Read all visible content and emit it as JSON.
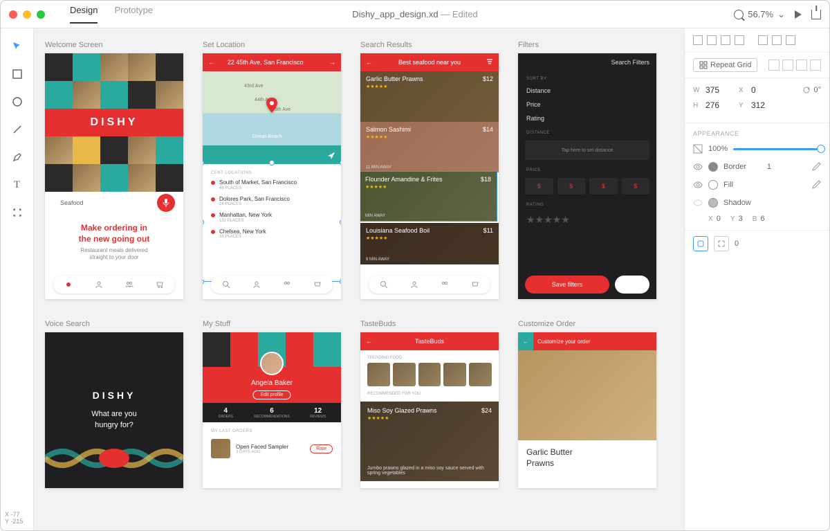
{
  "titlebar": {
    "modes": [
      "Design",
      "Prototype"
    ],
    "active_mode": 0,
    "document": "Dishy_app_design.xd",
    "edited": " — Edited",
    "zoom": "56.7%"
  },
  "coords": {
    "x": "X   -77",
    "y": "Y   -215"
  },
  "artboards_row1": [
    {
      "label": "Welcome Screen"
    },
    {
      "label": "Set Location"
    },
    {
      "label": "Search Results"
    },
    {
      "label": "Filters"
    }
  ],
  "artboards_row2": [
    {
      "label": "Voice Search"
    },
    {
      "label": "My Stuff"
    },
    {
      "label": "TasteBuds"
    },
    {
      "label": "Customize Order"
    }
  ],
  "welcome": {
    "logo": "DISHY",
    "search": "Seafood",
    "tagline": "Make ordering in\nthe new going out",
    "sub": "Restaurant meals delivered\nstraight to your door"
  },
  "location": {
    "header": "22 45th Ave, San Francisco",
    "streets": [
      "43rd Ave",
      "44th Ave",
      "45th Ave",
      "Ocean Beach"
    ],
    "section": "CENT LOCATIONS",
    "items": [
      {
        "name": "South of Market, San Francisco",
        "sub": "46 PLACES"
      },
      {
        "name": "Dolores Park, San Francisco",
        "sub": "24 PLACES"
      },
      {
        "name": "Manhattan, New York",
        "sub": "133 PLACES"
      },
      {
        "name": "Chelsea, New York",
        "sub": "39 PLACES"
      }
    ]
  },
  "search": {
    "header": "Best seafood near you",
    "dishes": [
      {
        "name": "Garlic Butter Prawns",
        "price": "$12",
        "stars": "★★★★★",
        "dist": ""
      },
      {
        "name": "Salmon Sashimi",
        "price": "$14",
        "stars": "★★★★★",
        "dist": "11 MIN AWAY"
      },
      {
        "name": "Flounder Amandine & Frites",
        "price": "$18",
        "stars": "★★★★★",
        "dist": "MIN AWAY"
      },
      {
        "name": "Louisiana Seafood Boil",
        "price": "$11",
        "stars": "★★★★★",
        "dist": "8 MIN AWAY"
      }
    ]
  },
  "filters": {
    "header": "Search Filters",
    "sortby": "SORT BY",
    "opts": [
      "Distance",
      "Price",
      "Rating"
    ],
    "distance": "DISTANCE",
    "dist_hint": "Tap here to set distance",
    "price": "PRICE",
    "p_symbols": [
      "$",
      "$",
      "$",
      "$"
    ],
    "rating": "RATING",
    "save": "Save filters"
  },
  "voice": {
    "logo": "DISHY",
    "q": "What are you\nhungry for?"
  },
  "mystuff": {
    "name": "Angela Baker",
    "edit": "Edit profile",
    "stats": [
      {
        "n": "4",
        "l": "ORDERS"
      },
      {
        "n": "6",
        "l": "RECOMMENDATIONS"
      },
      {
        "n": "12",
        "l": "REVIEWS"
      }
    ],
    "orders_h": "MY LAST ORDERS",
    "order": {
      "name": "Open Faced Sampler",
      "date": "3 DAYS AGO",
      "rate": "Rate"
    }
  },
  "tastebuds": {
    "header": "TasteBuds",
    "s1": "TRENDING FOOD",
    "s2": "RECOMMENDED FOR YOU",
    "card": {
      "name": "Miso Soy Glazed Prawns",
      "price": "$24",
      "stars": "★★★★★",
      "desc": "Jumbo prawns glazed in a miso soy sauce served with spring vegetables"
    }
  },
  "customize": {
    "header": "Customize your order",
    "name": "Garlic Butter\nPrawns"
  },
  "panel": {
    "repeat": "Repeat Grid",
    "w": "375",
    "x": "0",
    "h": "276",
    "y": "312",
    "rot": "0°",
    "appearance": "APPEARANCE",
    "opacity": "100%",
    "border": "Border",
    "border_w": "1",
    "fill": "Fill",
    "shadow": "Shadow",
    "sx": "0",
    "sy": "3",
    "sb": "6",
    "corner": "0"
  }
}
